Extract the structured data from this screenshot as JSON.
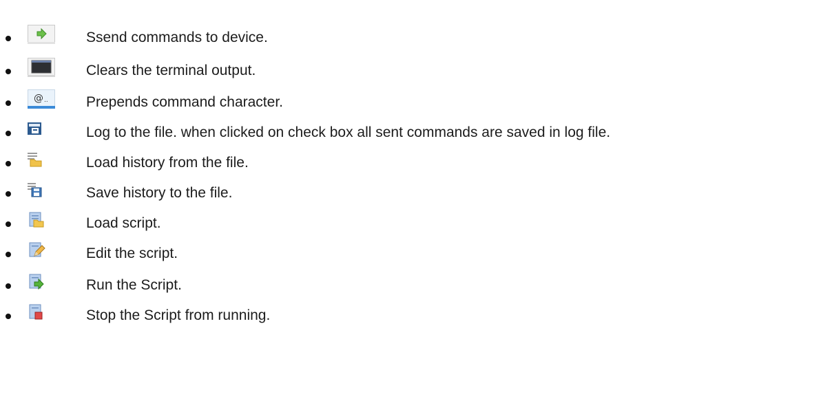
{
  "items": [
    {
      "icon": "send-arrow-icon",
      "text": "Ssend commands to device."
    },
    {
      "icon": "terminal-window-icon",
      "text": "Clears the terminal output."
    },
    {
      "icon": "at-command-character-icon",
      "text": "Prepends command character."
    },
    {
      "icon": "log-save-icon",
      "text": "Log to the file. when clicked on check box all sent commands are saved in log file."
    },
    {
      "icon": "history-load-icon",
      "text": "Load history from the file."
    },
    {
      "icon": "history-save-icon",
      "text": "Save history to the file."
    },
    {
      "icon": "script-load-icon",
      "text": "Load script."
    },
    {
      "icon": "script-edit-icon",
      "text": "Edit the script."
    },
    {
      "icon": "script-run-icon",
      "text": "Run the Script."
    },
    {
      "icon": "script-stop-icon",
      "text": "Stop the Script from running."
    }
  ]
}
